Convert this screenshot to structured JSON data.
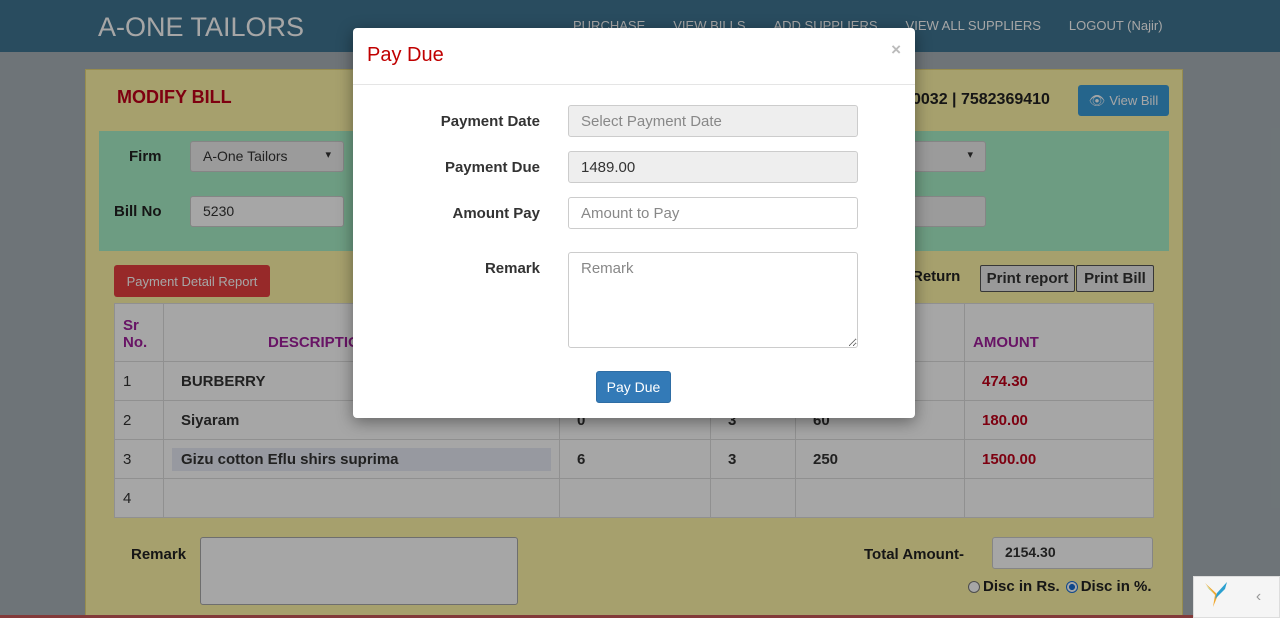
{
  "app": {
    "brand": "A-ONE TAILORS",
    "nav": [
      "PURCHASE",
      "VIEW BILLS",
      "ADD SUPPLIERS",
      "VIEW ALL SUPPLIERS",
      "LOGOUT (Najir)"
    ]
  },
  "bill": {
    "title": "MODIFY BILL",
    "phone": "0032 | 7582369410",
    "view_bill_label": "View Bill",
    "firm_label": "Firm",
    "firm_value": "A-One Tailors",
    "bill_no_label": "Bill No",
    "bill_no_value": "5230",
    "payment_report_label": "Payment Detail Report",
    "return_label": "Return",
    "print_report_label": "Print report",
    "print_bill_label": "Print Bill",
    "table": {
      "headers": [
        "Sr No.",
        "DESCRIPTIO",
        "",
        "",
        "",
        "AMOUNT"
      ],
      "rows": [
        {
          "sr": "1",
          "desc": "BURBERRY",
          "c3": "",
          "c4": "",
          "c5": "",
          "amount": "474.30"
        },
        {
          "sr": "2",
          "desc": "Siyaram",
          "c3": "0",
          "c4": "3",
          "c5": "60",
          "amount": "180.00"
        },
        {
          "sr": "3",
          "desc": "Gizu cotton Eflu shirs suprima",
          "c3": "6",
          "c4": "3",
          "c5": "250",
          "amount": "1500.00"
        },
        {
          "sr": "4",
          "desc": "",
          "c3": "",
          "c4": "",
          "c5": "",
          "amount": ""
        }
      ]
    },
    "remark_label": "Remark",
    "total_label": "Total Amount-",
    "total_value": "2154.30",
    "disc_rs_label": "Disc in Rs.",
    "disc_pct_label": "Disc in %."
  },
  "modal": {
    "title": "Pay Due",
    "close_symbol": "×",
    "payment_date_label": "Payment Date",
    "payment_date_placeholder": "Select Payment Date",
    "payment_due_label": "Payment Due",
    "payment_due_value": "1489.00",
    "amount_pay_label": "Amount Pay",
    "amount_pay_placeholder": "Amount to Pay",
    "remark_label": "Remark",
    "remark_placeholder": "Remark",
    "submit_label": "Pay Due"
  },
  "colors": {
    "navbar": "#3f7592",
    "panel": "#fff6a8",
    "modal_title": "#c00000",
    "primary_button": "#337ab7",
    "danger_button": "#e84040"
  },
  "icons": {
    "view_bill": "eye-icon",
    "close": "close-icon",
    "yii": "yii-logo-icon",
    "collapse": "chevron-left-icon"
  }
}
